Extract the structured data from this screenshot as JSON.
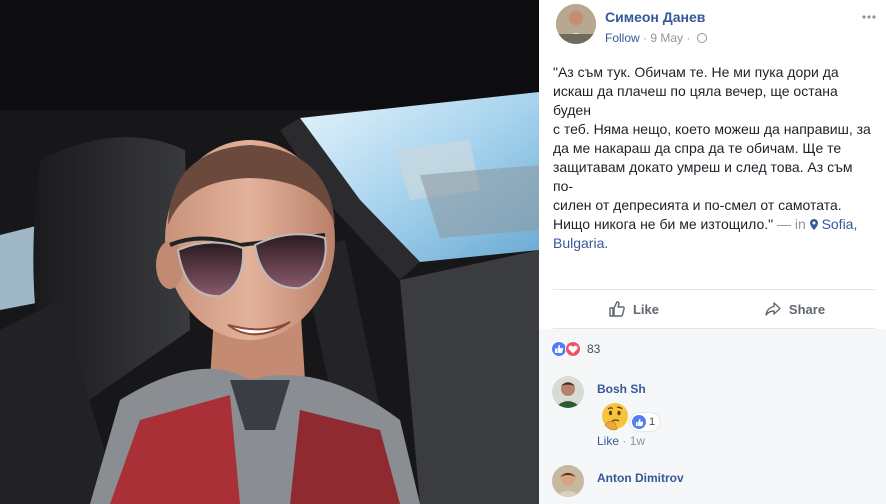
{
  "post": {
    "author": "Симеон Данев",
    "follow": "Follow",
    "separator": "·",
    "date": "9 May",
    "date_separator": "·",
    "options_icon": "ellipsis-icon",
    "text_lines": [
      "\"Аз съм тук. Обичам те. Не ми пука дори да",
      "искаш да плачеш по цяла вечер, ще остана буден",
      "с теб. Няма нещо, което можеш да направиш, за",
      "да ме накараш да спра да те обичам. Ще те",
      "защитавам докато умреш и след това. Аз съм по-",
      "силен от депресията и по-смел от самотата.",
      "Нищо никога не би ме изтощило.\""
    ],
    "location_prefix": "— in",
    "location": "Sofia,",
    "location_line2": "Bulgaria."
  },
  "actions": {
    "like_label": "Like",
    "share_label": "Share"
  },
  "reactions": {
    "count": "83",
    "types": [
      "like",
      "love"
    ]
  },
  "comments": [
    {
      "author": "Bosh Sh",
      "sticker": "thinking-face",
      "reaction_count": "1",
      "like_label": "Like",
      "meta_separator": "·",
      "age": "1w"
    },
    {
      "author": "Anton Dimitrov"
    }
  ],
  "colors": {
    "link": "#365899",
    "meta": "#90949c",
    "text": "#1d2129",
    "like_blue": "#4f7ef5",
    "love_red": "#f25268",
    "feedback_bg": "#f6f7f9"
  }
}
